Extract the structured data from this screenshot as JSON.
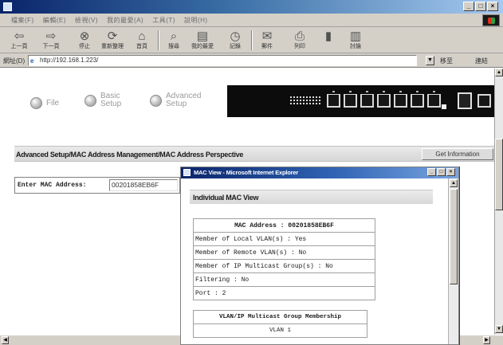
{
  "menubar": {
    "items": [
      "檔案(F)",
      "編輯(E)",
      "檢視(V)",
      "我的最愛(A)",
      "工具(T)",
      "說明(H)"
    ]
  },
  "toolbar": {
    "buttons": [
      {
        "label": "上一頁",
        "icon": "back-arrow-icon"
      },
      {
        "label": "下一頁",
        "icon": "forward-arrow-icon"
      },
      {
        "label": "停止",
        "icon": "stop-icon"
      },
      {
        "label": "重新整理",
        "icon": "refresh-icon"
      },
      {
        "label": "首頁",
        "icon": "home-icon"
      },
      {
        "label": "搜尋",
        "icon": "search-icon"
      },
      {
        "label": "我的最愛",
        "icon": "favorites-icon"
      },
      {
        "label": "記錄",
        "icon": "history-icon"
      },
      {
        "label": "郵件",
        "icon": "mail-icon"
      },
      {
        "label": "列印",
        "icon": "print-icon"
      },
      {
        "label": "",
        "icon": "edit-icon"
      },
      {
        "label": "討論",
        "icon": "discuss-icon"
      }
    ]
  },
  "addressbar": {
    "label": "網址(D)",
    "url": "http://192.168.1.223/",
    "go_label": "移至",
    "links_label": "連結"
  },
  "nav": {
    "file": "File",
    "basic_setup": "Basic Setup",
    "advanced_setup": "Advanced Setup"
  },
  "header": {
    "breadcrumb": "Advanced Setup/MAC Address Management/MAC Address Perspective",
    "get_info_button": "Get Information"
  },
  "mac_entry": {
    "label": "Enter MAC Address:",
    "value": "00201858EB6F"
  },
  "popup": {
    "title": "MAC View - Microsoft Internet Explorer",
    "section_title": "Individual MAC View",
    "mac_header": "MAC Address : 00201858EB6F",
    "rows": [
      "Member of Local VLAN(s) : Yes",
      "Member of Remote VLAN(s) : No",
      "Member of IP Multicast Group(s) : No",
      "Filtering : No",
      "Port : 2"
    ],
    "multicast_header": "VLAN/IP Multicast Group Membership",
    "multicast_rows": [
      "VLAN 1"
    ]
  }
}
